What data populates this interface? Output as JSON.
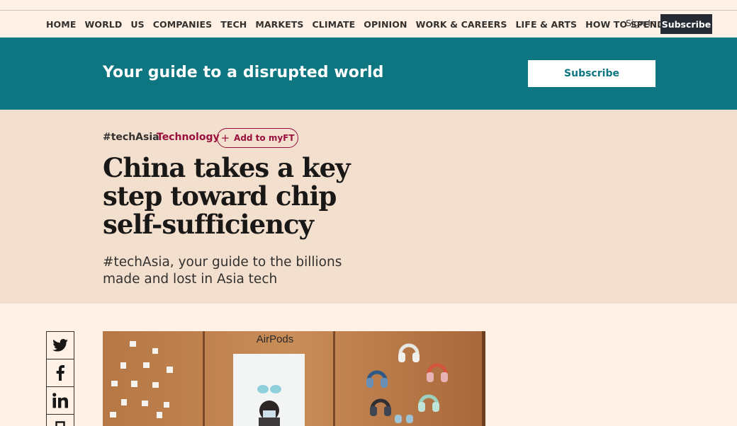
{
  "nav": {
    "items": [
      "HOME",
      "WORLD",
      "US",
      "COMPANIES",
      "TECH",
      "MARKETS",
      "CLIMATE",
      "OPINION",
      "WORK & CAREERS",
      "LIFE & ARTS",
      "HOW TO SPEND IT"
    ],
    "sign_in": "Sign In",
    "subscribe": "Subscribe"
  },
  "banner": {
    "text": "Your guide to a disrupted world",
    "button": "Subscribe"
  },
  "article": {
    "primary_tag": "#techAsia",
    "secondary_tag": "Technology",
    "myft_label": "Add to myFT",
    "headline": "China takes a key step toward chip self-sufficiency",
    "standfirst": "#techAsia, your guide to the billions made and lost in Asia tech"
  },
  "photo": {
    "sign_text": "AirPods"
  },
  "share": [
    "twitter-icon",
    "facebook-icon",
    "linkedin-icon",
    "save-icon"
  ],
  "colors": {
    "page_bg": "#fff1e5",
    "teal": "#0d7680",
    "hero_bg": "#f2dfce",
    "claret": "#990f3d",
    "dark_button": "#262a33"
  }
}
